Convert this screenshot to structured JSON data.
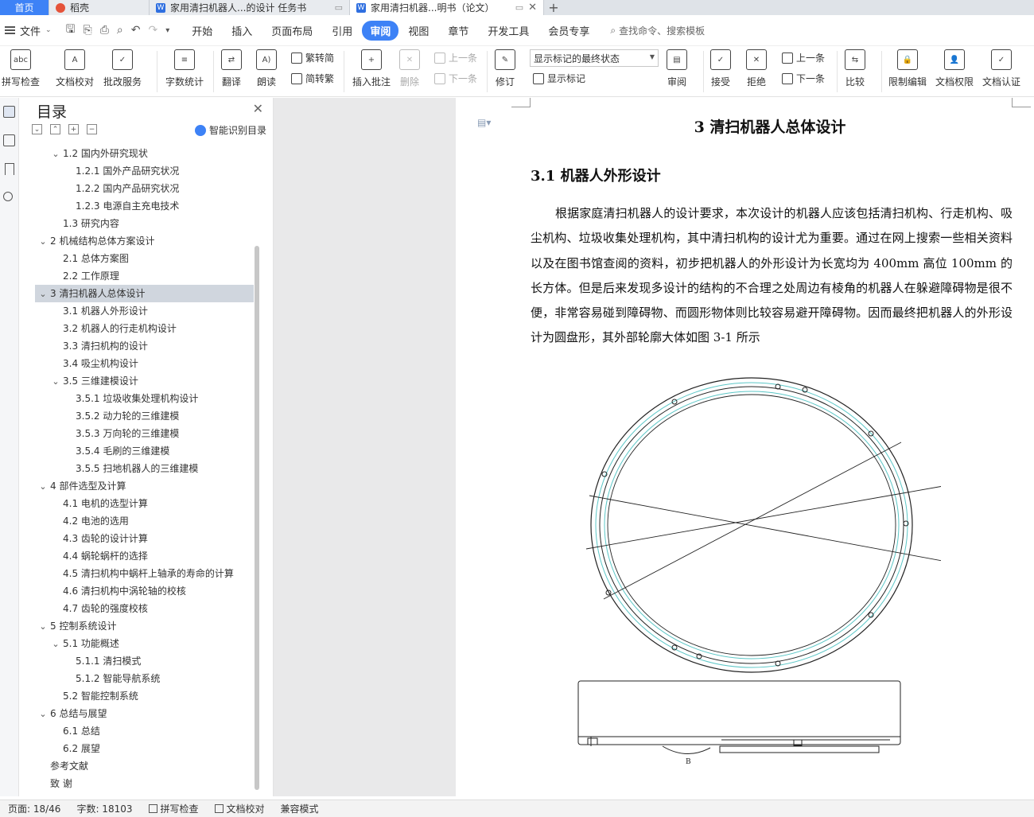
{
  "tabs": [
    {
      "label": "首页",
      "type": "home"
    },
    {
      "label": "稻壳",
      "type": "docer"
    },
    {
      "label": "家用清扫机器人...的设计 任务书",
      "type": "doc"
    },
    {
      "label": "家用清扫机器...明书（论文）",
      "type": "doc",
      "active": true
    }
  ],
  "menu": {
    "file_label": "文件",
    "items": [
      "开始",
      "插入",
      "页面布局",
      "引用",
      "审阅",
      "视图",
      "章节",
      "开发工具",
      "会员专享"
    ],
    "active": "审阅",
    "search_placeholder": "查找命令、搜索模板"
  },
  "ribbon": {
    "spellcheck": "拼写检查",
    "doc_proof": "文档校对",
    "review_service": "批改服务",
    "word_count": "字数统计",
    "translate": "翻译",
    "read_aloud": "朗读",
    "to_traditional": "繁转简",
    "to_simplified": "简转繁",
    "insert_comment": "插入批注",
    "delete": "删除",
    "prev_comment": "上一条",
    "next_comment": "下一条",
    "track_changes": "修订",
    "markup_mode": "显示标记的最终状态",
    "show_markup": "显示标记",
    "review": "审阅",
    "accept": "接受",
    "reject": "拒绝",
    "prev_change": "上一条",
    "next_change": "下一条",
    "compare": "比较",
    "restrict_edit": "限制编辑",
    "doc_permission": "文档权限",
    "doc_auth": "文档认证"
  },
  "toc": {
    "title": "目录",
    "smart_label": "智能识别目录",
    "items": [
      {
        "text": "1.2  国内外研究现状",
        "level": 2,
        "caret": "v"
      },
      {
        "text": "1.2.1  国外产品研究状况",
        "level": 3
      },
      {
        "text": "1.2.2  国内产品研究状况",
        "level": 3
      },
      {
        "text": "1.2.3  电源自主充电技术",
        "level": 3
      },
      {
        "text": "1.3  研究内容",
        "level": 2
      },
      {
        "text": "2  机械结构总体方案设计",
        "level": 1,
        "caret": "v"
      },
      {
        "text": "2.1  总体方案图",
        "level": 2
      },
      {
        "text": "2.2  工作原理",
        "level": 2
      },
      {
        "text": "3  清扫机器人总体设计",
        "level": 1,
        "caret": "v",
        "selected": true
      },
      {
        "text": "3.1  机器人外形设计",
        "level": 2
      },
      {
        "text": "3.2  机器人的行走机构设计",
        "level": 2
      },
      {
        "text": "3.3  清扫机构的设计",
        "level": 2
      },
      {
        "text": "3.4  吸尘机构设计",
        "level": 2
      },
      {
        "text": "3.5  三维建模设计",
        "level": 2,
        "caret": "v"
      },
      {
        "text": "3.5.1  垃圾收集处理机构设计",
        "level": 3
      },
      {
        "text": "3.5.2  动力轮的三维建模",
        "level": 3
      },
      {
        "text": "3.5.3  万向轮的三维建模",
        "level": 3
      },
      {
        "text": "3.5.4  毛刷的三维建模",
        "level": 3
      },
      {
        "text": "3.5.5  扫地机器人的三维建模",
        "level": 3
      },
      {
        "text": "4  部件选型及计算",
        "level": 1,
        "caret": "v"
      },
      {
        "text": "4.1  电机的选型计算",
        "level": 2
      },
      {
        "text": "4.2  电池的选用",
        "level": 2
      },
      {
        "text": "4.3  齿轮的设计计算",
        "level": 2
      },
      {
        "text": "4.4  蜗轮蜗杆的选择",
        "level": 2
      },
      {
        "text": "4.5  清扫机构中蜗杆上轴承的寿命的计算",
        "level": 2
      },
      {
        "text": "4.6  清扫机构中涡轮轴的校核",
        "level": 2
      },
      {
        "text": "4.7  齿轮的强度校核",
        "level": 2
      },
      {
        "text": "5  控制系统设计",
        "level": 1,
        "caret": "v"
      },
      {
        "text": "5.1  功能概述",
        "level": 2,
        "caret": "v"
      },
      {
        "text": "5.1.1  清扫模式",
        "level": 3
      },
      {
        "text": "5.1.2  智能导航系统",
        "level": 3
      },
      {
        "text": "5.2  智能控制系统",
        "level": 2
      },
      {
        "text": "6  总结与展望",
        "level": 1,
        "caret": "v"
      },
      {
        "text": "6.1  总结",
        "level": 2
      },
      {
        "text": "6.2  展望",
        "level": 2
      },
      {
        "text": "参考文献",
        "level": 1
      },
      {
        "text": "致    谢",
        "level": 1
      }
    ]
  },
  "document": {
    "chapter_title": "3  清扫机器人总体设计",
    "section_title": "3.1  机器人外形设计",
    "paragraph": "根据家庭清扫机器人的设计要求，本次设计的机器人应该包括清扫机构、行走机构、吸尘机构、垃圾收集处理机构，其中清扫机构的设计尤为重要。通过在网上搜索一些相关资料以及在图书馆查阅的资料，初步把机器人的外形设计为长宽均为 400mm 高位 100mm 的长方体。但是后来发现多设计的结构的不合理之处周边有棱角的机器人在躲避障碍物是很不便，非常容易碰到障碍物、而圆形物体则比较容易避开障碍物。因而最终把机器人的外形设计为圆盘形，其外部轮廓大体如图 3-1 所示",
    "figure_label": "B"
  },
  "status": {
    "page": "页面: 18/46",
    "words": "字数: 18103",
    "spellcheck": "拼写检查",
    "proof": "文档校对",
    "compat": "兼容模式"
  }
}
